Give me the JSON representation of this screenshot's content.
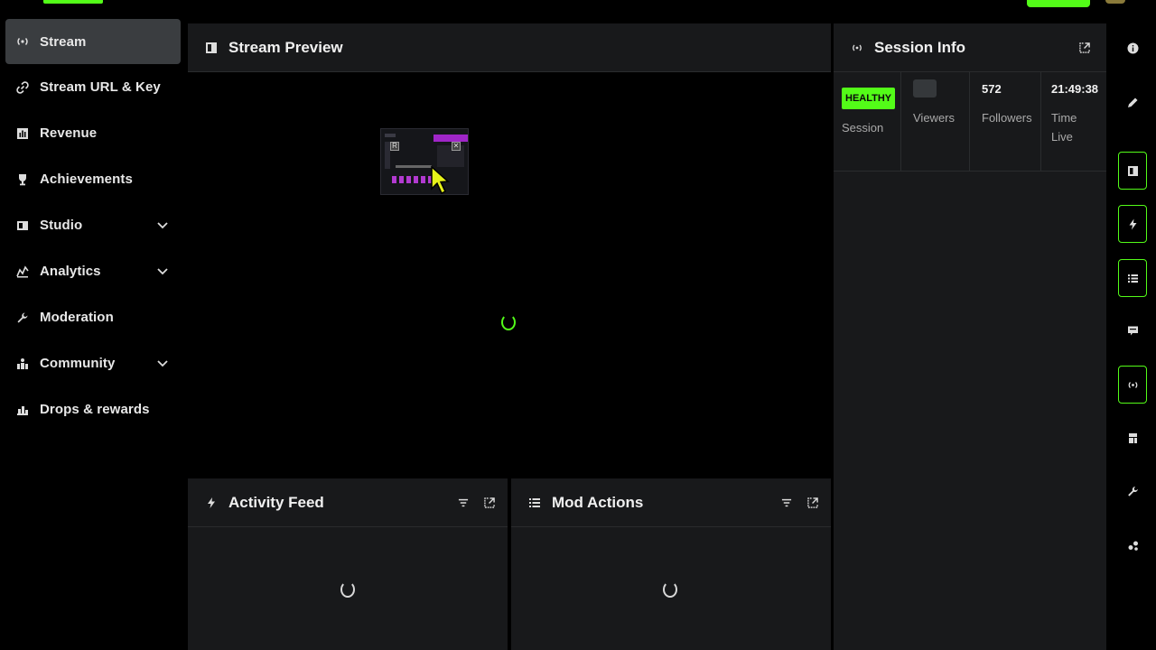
{
  "sidebar": {
    "items": [
      {
        "label": "Stream",
        "icon": "broadcast-icon",
        "active": true
      },
      {
        "label": "Stream URL & Key",
        "icon": "link-icon"
      },
      {
        "label": "Revenue",
        "icon": "chart-icon"
      },
      {
        "label": "Achievements",
        "icon": "trophy-icon"
      },
      {
        "label": "Studio",
        "icon": "studio-icon",
        "expandable": true
      },
      {
        "label": "Analytics",
        "icon": "analytics-icon",
        "expandable": true
      },
      {
        "label": "Moderation",
        "icon": "wrench-icon"
      },
      {
        "label": "Community",
        "icon": "community-icon",
        "expandable": true
      },
      {
        "label": "Drops & rewards",
        "icon": "gift-icon"
      }
    ]
  },
  "preview": {
    "title": "Stream Preview"
  },
  "activity": {
    "title": "Activity Feed"
  },
  "mod_actions": {
    "title": "Mod Actions"
  },
  "session": {
    "title": "Session Info",
    "stats": [
      {
        "value": "HEALTHY",
        "label": "Session"
      },
      {
        "value": "",
        "label": "Viewers"
      },
      {
        "value": "572",
        "label": "Followers"
      },
      {
        "value": "21:49:38",
        "label": "Time Live"
      }
    ]
  },
  "colors": {
    "accent": "#53fc18",
    "panel": "#18191b",
    "active_nav": "#3a3d40"
  }
}
